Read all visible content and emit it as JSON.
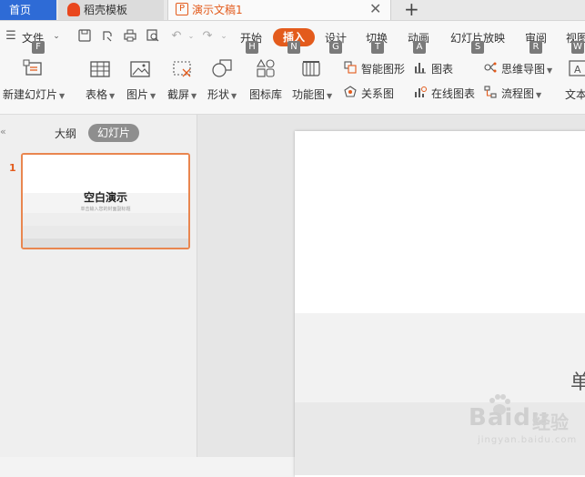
{
  "tabs": {
    "home": "首页",
    "template": "稻壳模板",
    "document": "演示文稿1"
  },
  "menu": {
    "file": "文件",
    "items": [
      {
        "label": "开始",
        "key": "H"
      },
      {
        "label": "插入",
        "key": "N"
      },
      {
        "label": "设计",
        "key": "G"
      },
      {
        "label": "切换",
        "key": "T"
      },
      {
        "label": "动画",
        "key": "A"
      },
      {
        "label": "幻灯片放映",
        "key": "S"
      },
      {
        "label": "审阅",
        "key": "R"
      },
      {
        "label": "视图",
        "key": "W"
      }
    ],
    "file_key": "F"
  },
  "ribbon": {
    "new_slide": "新建幻灯片",
    "table": "表格",
    "picture": "图片",
    "screenshot": "截屏",
    "shape": "形状",
    "icon_lib": "图标库",
    "function_chart": "功能图",
    "smart_graphic": "智能图形",
    "chart": "图表",
    "mind_map": "思维导图",
    "relation": "关系图",
    "online_chart": "在线图表",
    "flowchart": "流程图",
    "text": "文本"
  },
  "left_panel": {
    "outline": "大纲",
    "slides": "幻灯片",
    "slide_number": "1",
    "thumb_title": "空白演示",
    "thumb_subtitle": "单击输入您的封面副标题"
  },
  "canvas": {
    "partial_text": "单"
  },
  "watermark": {
    "brand": "Bai",
    "brand2": "du",
    "cn": "经验",
    "url": "jingyan.baidu.com"
  }
}
